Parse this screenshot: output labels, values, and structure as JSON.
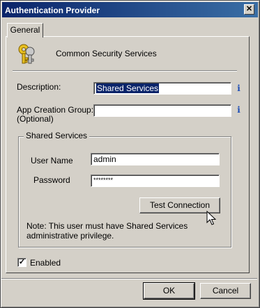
{
  "window": {
    "title": "Authentication Provider",
    "close_glyph": "✕"
  },
  "tabs": [
    {
      "label": "General"
    }
  ],
  "header": {
    "text": "Common Security Services",
    "icon": "keys-icon"
  },
  "form": {
    "description_label": "Description:",
    "description_value": "Shared Services",
    "app_group_label_line1": "App Creation Group:",
    "app_group_label_line2": "(Optional)",
    "app_group_value": "",
    "info_glyph": "i"
  },
  "shared_services": {
    "group_title": "Shared Services",
    "username_label": "User Name",
    "username_value": "admin",
    "password_label": "Password",
    "password_value": "********",
    "test_button": "Test Connection",
    "note_line1": "Note: This user must have Shared Services",
    "note_line2": "administrative privilege."
  },
  "enabled": {
    "label": "Enabled",
    "checked": true,
    "check_glyph": "✓"
  },
  "footer": {
    "ok_label": "OK",
    "cancel_label": "Cancel"
  },
  "colors": {
    "titlebar": "#0a246a",
    "face": "#d4d0c8",
    "selection": "#0a246a",
    "info": "#1a4bb5"
  }
}
